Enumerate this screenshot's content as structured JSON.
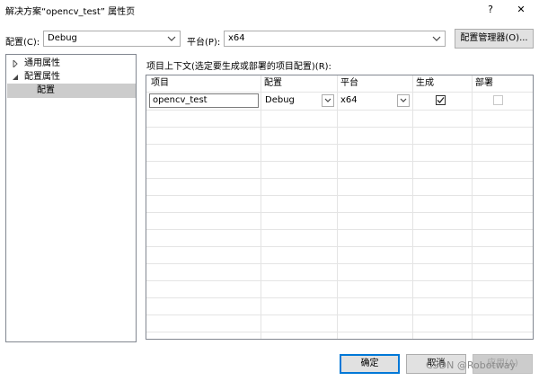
{
  "window": {
    "title": "解决方案“opencv_test” 属性页",
    "help": "?",
    "close": "✕"
  },
  "toolbar": {
    "config_label": "配置(C):",
    "config_value": "Debug",
    "platform_label": "平台(P):",
    "platform_value": "x64",
    "config_manager": "配置管理器(O)..."
  },
  "tree": {
    "items": [
      {
        "label": "通用属性",
        "expanded": false
      },
      {
        "label": "配置属性",
        "expanded": true
      },
      {
        "label": "配置",
        "selected": true
      }
    ]
  },
  "grid": {
    "caption": "项目上下文(选定要生成或部署的项目配置)(R):",
    "headers": [
      "项目",
      "配置",
      "平台",
      "生成",
      "部署"
    ],
    "rows": [
      {
        "project": "opencv_test",
        "configuration": "Debug",
        "platform": "x64",
        "build": true,
        "deploy": false,
        "deploy_enabled": false
      }
    ]
  },
  "footer": {
    "ok": "确定",
    "cancel": "取消",
    "apply": "应用(A)"
  },
  "watermark": "CSDN @Robotway",
  "colors": {
    "accent": "#0078d7",
    "selection": "#cccccc",
    "border": "#828790"
  }
}
